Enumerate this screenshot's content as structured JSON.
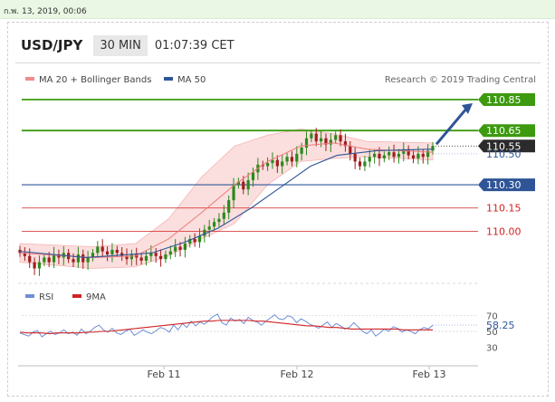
{
  "header": {
    "date_text": "ก.พ. 13, 2019, 00:06",
    "pair": "USD/JPY",
    "timeframe": "30 MIN",
    "time": "01:07:39 CET"
  },
  "legend": {
    "ma_bb_label": "MA 20 + Bollinger Bands",
    "ma50_label": "MA 50",
    "credit": "Research © 2019 Trading Central",
    "ma_bb_color": "#f28b8b",
    "ma50_color": "#2f5597"
  },
  "colors": {
    "green": "#3d9a10",
    "blue": "#2f5597",
    "red": "#d22222",
    "bull": "#2a8a1c",
    "bear": "#a01d1d",
    "band": "#fbdede",
    "arrow": "#2f5597",
    "rsi": "#6d8fd6",
    "ma9": "#d22222"
  },
  "chart_data": [
    {
      "type": "candlestick",
      "ylim": [
        109.71,
        110.92
      ],
      "x_ticks": [
        "Feb 11",
        "Feb 12",
        "Feb 13"
      ],
      "levels": [
        {
          "value": 110.85,
          "label": "110.85",
          "style": "green-flag"
        },
        {
          "value": 110.65,
          "label": "110.65",
          "style": "green-flag"
        },
        {
          "value": 110.55,
          "label": "110.55",
          "style": "dark-flag"
        },
        {
          "value": 110.5,
          "label": "110.50",
          "style": "text-blue"
        },
        {
          "value": 110.3,
          "label": "110.30",
          "style": "blue-flag"
        },
        {
          "value": 110.15,
          "label": "110.15",
          "style": "text-red"
        },
        {
          "value": 110.0,
          "label": "110.00",
          "style": "text-red"
        }
      ],
      "arrow": {
        "from": 110.55,
        "to": 110.85
      },
      "close_path": [
        109.86,
        109.84,
        109.8,
        109.76,
        109.8,
        109.83,
        109.8,
        109.85,
        109.83,
        109.86,
        109.82,
        109.8,
        109.85,
        109.8,
        109.83,
        109.86,
        109.9,
        109.87,
        109.85,
        109.88,
        109.86,
        109.84,
        109.82,
        109.85,
        109.83,
        109.81,
        109.84,
        109.86,
        109.84,
        109.82,
        109.85,
        109.87,
        109.9,
        109.88,
        109.92,
        109.95,
        109.93,
        109.97,
        110.01,
        110.03,
        110.06,
        110.08,
        110.12,
        110.2,
        110.3,
        110.32,
        110.27,
        110.33,
        110.38,
        110.43,
        110.42,
        110.44,
        110.46,
        110.42,
        110.45,
        110.48,
        110.45,
        110.5,
        110.54,
        110.6,
        110.63,
        110.58,
        110.6,
        110.56,
        110.59,
        110.62,
        110.58,
        110.55,
        110.5,
        110.45,
        110.42,
        110.45,
        110.48,
        110.5,
        110.47,
        110.49,
        110.51,
        110.48,
        110.5,
        110.53,
        110.49,
        110.47,
        110.5,
        110.48,
        110.52,
        110.55
      ],
      "ma50": [
        [
          0,
          109.87
        ],
        [
          20,
          109.83
        ],
        [
          40,
          109.86
        ],
        [
          50,
          109.93
        ],
        [
          60,
          110.02
        ],
        [
          70,
          110.15
        ],
        [
          80,
          110.3
        ],
        [
          88,
          110.42
        ],
        [
          96,
          110.49
        ],
        [
          108,
          110.52
        ],
        [
          125,
          110.53
        ]
      ],
      "ma20": [
        [
          0,
          109.86
        ],
        [
          22,
          109.83
        ],
        [
          35,
          109.84
        ],
        [
          45,
          109.95
        ],
        [
          55,
          110.12
        ],
        [
          65,
          110.3
        ],
        [
          75,
          110.45
        ],
        [
          85,
          110.55
        ],
        [
          95,
          110.57
        ],
        [
          105,
          110.53
        ],
        [
          125,
          110.51
        ]
      ],
      "band_upper": [
        [
          0,
          109.92
        ],
        [
          22,
          109.9
        ],
        [
          35,
          109.92
        ],
        [
          45,
          110.08
        ],
        [
          55,
          110.35
        ],
        [
          65,
          110.55
        ],
        [
          75,
          110.62
        ],
        [
          85,
          110.66
        ],
        [
          95,
          110.63
        ],
        [
          105,
          110.58
        ],
        [
          125,
          110.57
        ]
      ],
      "band_lower": [
        [
          0,
          109.8
        ],
        [
          22,
          109.76
        ],
        [
          35,
          109.77
        ],
        [
          45,
          109.84
        ],
        [
          55,
          109.95
        ],
        [
          65,
          110.05
        ],
        [
          75,
          110.3
        ],
        [
          85,
          110.45
        ],
        [
          95,
          110.47
        ],
        [
          105,
          110.48
        ],
        [
          125,
          110.46
        ]
      ]
    },
    {
      "type": "line",
      "name": "RSI panel",
      "legend": [
        "RSI",
        "9MA"
      ],
      "ylim": [
        20,
        80
      ],
      "y_ticks": [
        70,
        50,
        30
      ],
      "last_value_label": "58.25",
      "rsi": [
        48,
        46,
        44,
        49,
        51,
        43,
        47,
        50,
        46,
        48,
        52,
        47,
        49,
        45,
        53,
        47,
        50,
        55,
        58,
        52,
        49,
        54,
        48,
        46,
        50,
        53,
        45,
        48,
        52,
        49,
        47,
        51,
        55,
        53,
        49,
        58,
        52,
        60,
        55,
        63,
        57,
        62,
        59,
        64,
        69,
        72,
        61,
        58,
        67,
        63,
        65,
        60,
        68,
        64,
        62,
        58,
        63,
        67,
        71,
        66,
        65,
        70,
        68,
        61,
        66,
        63,
        59,
        57,
        54,
        58,
        62,
        55,
        60,
        57,
        53,
        55,
        61,
        56,
        50,
        47,
        52,
        44,
        48,
        53,
        50,
        56,
        54,
        49,
        52,
        50,
        47,
        52,
        55,
        53,
        58
      ],
      "ma9": [
        49,
        48,
        48,
        48,
        47,
        48,
        48,
        48,
        48,
        49,
        49,
        50,
        50,
        51,
        52,
        53,
        54,
        55,
        56,
        57,
        58,
        59,
        60,
        61,
        62,
        63,
        63,
        64,
        64,
        64,
        64,
        64,
        63,
        63,
        62,
        61,
        60,
        59,
        58,
        57,
        57,
        56,
        55,
        55,
        54,
        53,
        53,
        53,
        53,
        53,
        53,
        53,
        52,
        52,
        52,
        52,
        52
      ]
    }
  ]
}
